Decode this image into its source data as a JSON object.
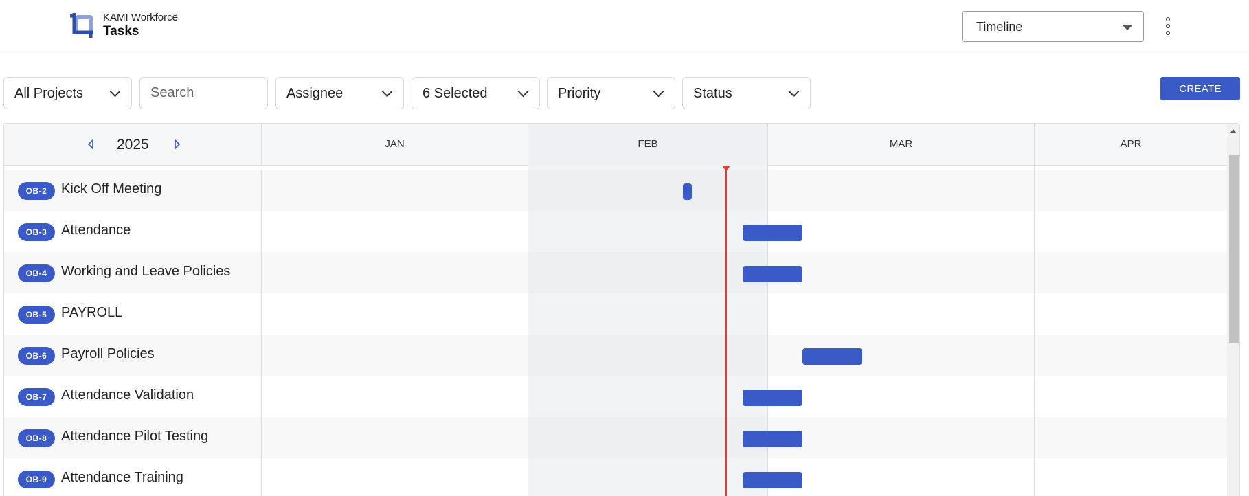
{
  "app": {
    "subtitle": "KAMI Workforce",
    "title": "Tasks"
  },
  "view": {
    "selected": "Timeline"
  },
  "filters": {
    "project": "All Projects",
    "search_placeholder": "Search",
    "assignee": "Assignee",
    "selection": "6 Selected",
    "priority": "Priority",
    "status": "Status"
  },
  "create_label": "CREATE",
  "timeline": {
    "year": "2025",
    "months": [
      "JAN",
      "FEB",
      "MAR",
      "APR"
    ],
    "current_month": "FEB"
  },
  "tasks": [
    {
      "key": "OB-2",
      "name": "Kick Off Meeting"
    },
    {
      "key": "OB-3",
      "name": "Attendance"
    },
    {
      "key": "OB-4",
      "name": "Working and Leave Policies"
    },
    {
      "key": "OB-5",
      "name": "PAYROLL"
    },
    {
      "key": "OB-6",
      "name": "Payroll Policies"
    },
    {
      "key": "OB-7",
      "name": "Attendance Validation"
    },
    {
      "key": "OB-8",
      "name": "Attendance Pilot Testing"
    },
    {
      "key": "OB-9",
      "name": "Attendance Training"
    }
  ],
  "colors": {
    "accent": "#3a5bc7",
    "today_line": "#e53935"
  },
  "icons": {
    "logo": "crop-logo-icon",
    "more": "more-vertical-icon",
    "prev_year": "caret-left-icon",
    "next_year": "caret-right-icon"
  }
}
